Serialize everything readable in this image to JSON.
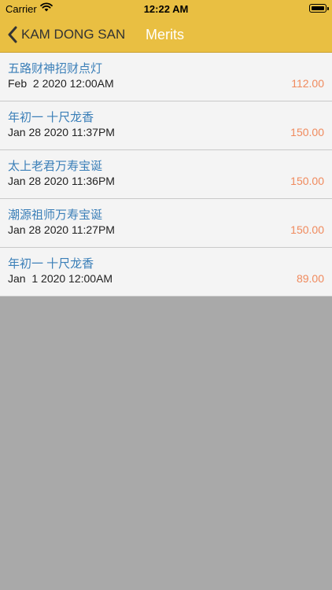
{
  "status_bar": {
    "carrier": "Carrier",
    "time": "12:22 AM"
  },
  "nav": {
    "back_label": "KAM DONG SAN",
    "title": "Merits"
  },
  "colors": {
    "header_bg": "#e9bf42",
    "title_text": "#3b7fb8",
    "amount_text": "#f08a5d",
    "empty_bg": "#a9a9a9"
  },
  "merits": [
    {
      "title": "五路财神招财点灯",
      "date": "Feb  2 2020 12:00AM",
      "amount": "112.00"
    },
    {
      "title": "年初一 十尺龙香",
      "date": "Jan 28 2020 11:37PM",
      "amount": "150.00"
    },
    {
      "title": "太上老君万寿宝诞",
      "date": "Jan 28 2020 11:36PM",
      "amount": "150.00"
    },
    {
      "title": "潮源祖师万寿宝诞",
      "date": "Jan 28 2020 11:27PM",
      "amount": "150.00"
    },
    {
      "title": "年初一 十尺龙香",
      "date": "Jan  1 2020 12:00AM",
      "amount": "89.00"
    }
  ]
}
